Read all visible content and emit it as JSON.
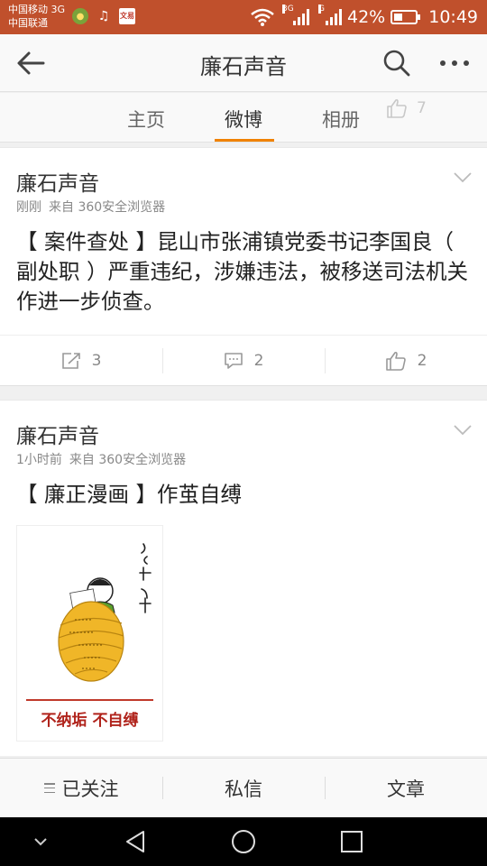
{
  "status_bar": {
    "carrier1": "中国移动 3G",
    "carrier2": "中国联通",
    "app_icon_news": "文易",
    "signal1_label": "3G",
    "signal2_label": "G",
    "battery": "42%",
    "battery_level": 0.42,
    "time": "10:49"
  },
  "header": {
    "title": "廉石声音"
  },
  "tabs": [
    {
      "label": "主页"
    },
    {
      "label": "微博"
    },
    {
      "label": "相册"
    }
  ],
  "tabs_extra": {
    "like_count": "7"
  },
  "posts": [
    {
      "author": "廉石声音",
      "time": "刚刚",
      "source": "来自 360安全浏览器",
      "text": "【 案件查处 】昆山市张浦镇党委书记李国良（ 副处职 ）严重违纪，涉嫌违法，被移送司法机关作进一步侦查。",
      "reposts": "3",
      "comments": "2",
      "likes": "2"
    },
    {
      "author": "廉石声音",
      "time": "1小时前",
      "source": "来自 360安全浏览器",
      "text": "【 廉正漫画 】作茧自缚",
      "image_caption": "不纳垢  不自缚",
      "image_side_text": "贪，则功自缚"
    }
  ],
  "bottom_bar": {
    "follow": "已关注",
    "message": "私信",
    "article": "文章"
  },
  "colors": {
    "status_bar": "#c0502c",
    "accent": "#f08200"
  }
}
